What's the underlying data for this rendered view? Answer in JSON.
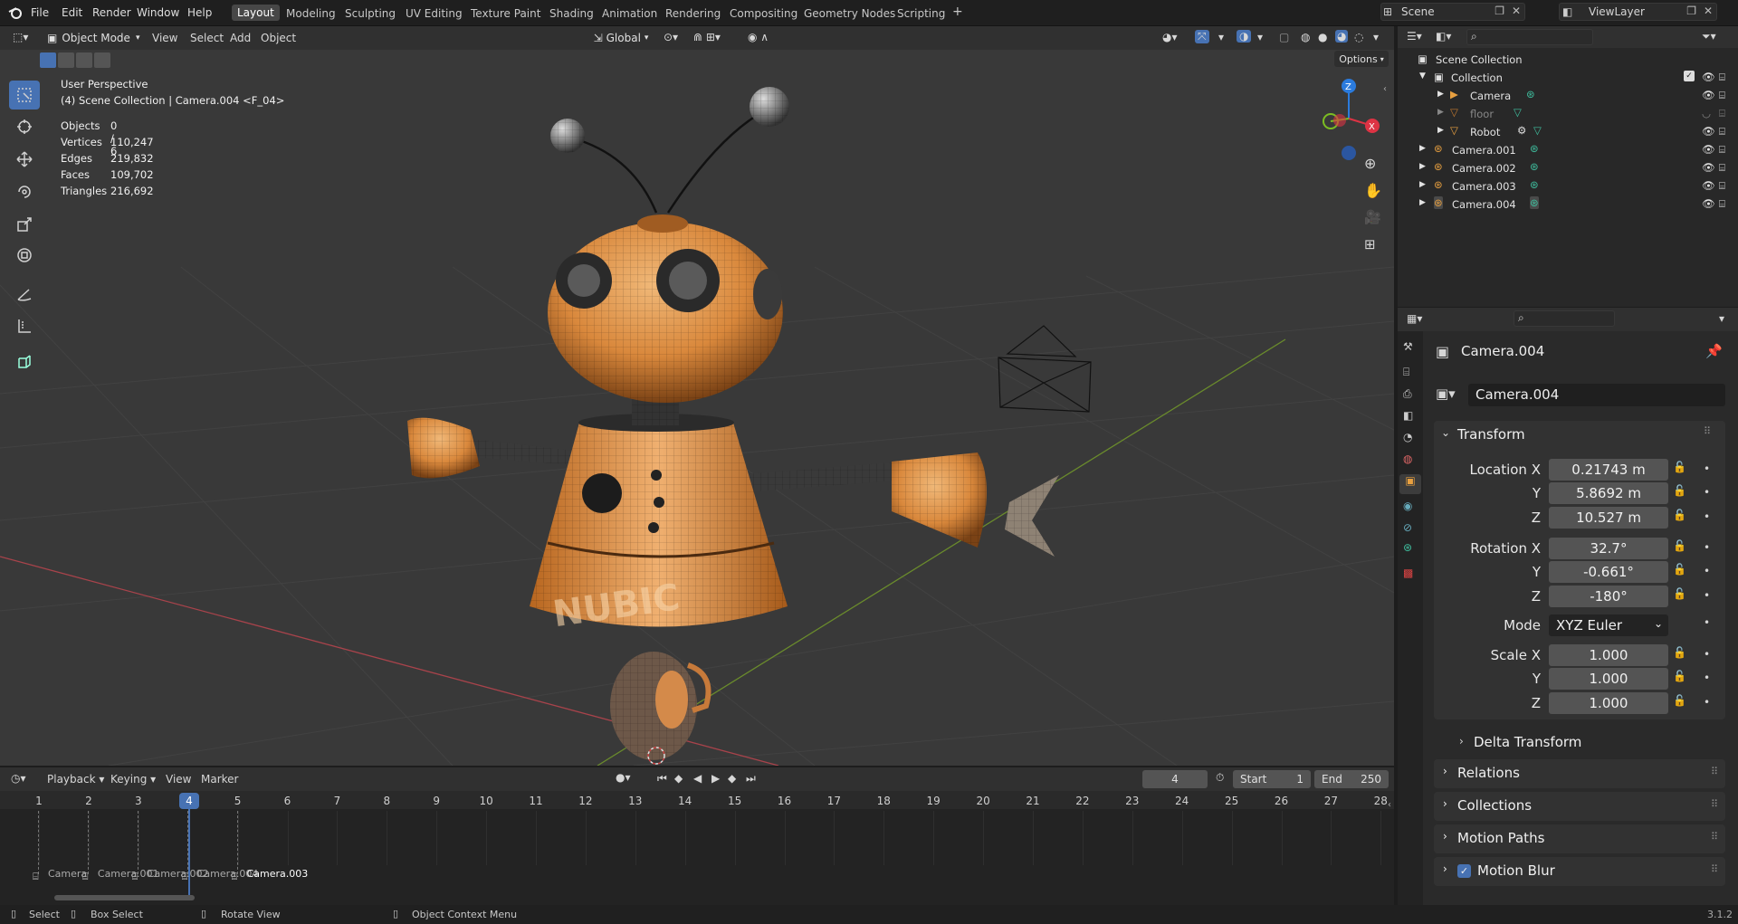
{
  "topbar": {
    "menus": [
      "File",
      "Edit",
      "Render",
      "Window",
      "Help"
    ],
    "workspaces": [
      "Layout",
      "Modeling",
      "Sculpting",
      "UV Editing",
      "Texture Paint",
      "Shading",
      "Animation",
      "Rendering",
      "Compositing",
      "Geometry Nodes",
      "Scripting"
    ],
    "active_workspace": "Layout",
    "add_tab": "+",
    "scene": "Scene",
    "view_layer": "ViewLayer"
  },
  "viewport": {
    "mode": "Object Mode",
    "menus": [
      "View",
      "Select",
      "Add",
      "Object"
    ],
    "orientation": "Global",
    "options": "Options",
    "perspective": "User Perspective",
    "collection_info": "(4) Scene Collection | Camera.004 <F_04>",
    "stats": [
      {
        "label": "Objects",
        "value": "0 / 6"
      },
      {
        "label": "Vertices",
        "value": "110,247"
      },
      {
        "label": "Edges",
        "value": "219,832"
      },
      {
        "label": "Faces",
        "value": "109,702"
      },
      {
        "label": "Triangles",
        "value": "216,692"
      }
    ],
    "gizmo": {
      "z": "Z",
      "y": "Y",
      "x": "X"
    },
    "model_text": "NUBIC"
  },
  "outliner": {
    "root": "Scene Collection",
    "items": [
      {
        "name": "Collection",
        "indent": 0
      },
      {
        "name": "Camera",
        "indent": 1
      },
      {
        "name": "floor",
        "indent": 1
      },
      {
        "name": "Robot",
        "indent": 1
      },
      {
        "name": "Camera.001",
        "indent": 0
      },
      {
        "name": "Camera.002",
        "indent": 0
      },
      {
        "name": "Camera.003",
        "indent": 0
      },
      {
        "name": "Camera.004",
        "indent": 0
      }
    ]
  },
  "properties": {
    "object_title": "Camera.004",
    "object_name": "Camera.004",
    "transform_label": "Transform",
    "location": {
      "label_x": "Location X",
      "label_y": "Y",
      "label_z": "Z",
      "x": "0.21743 m",
      "y": "5.8692 m",
      "z": "10.527 m"
    },
    "rotation": {
      "label_x": "Rotation X",
      "label_y": "Y",
      "label_z": "Z",
      "x": "32.7°",
      "y": "-0.661°",
      "z": "-180°"
    },
    "mode_label": "Mode",
    "mode_value": "XYZ Euler",
    "scale": {
      "label_x": "Scale X",
      "label_y": "Y",
      "label_z": "Z",
      "x": "1.000",
      "y": "1.000",
      "z": "1.000"
    },
    "delta": "Delta Transform",
    "sections": [
      "Relations",
      "Collections",
      "Motion Paths",
      "Motion Blur"
    ]
  },
  "timeline": {
    "menus": [
      "Playback",
      "Keying",
      "View",
      "Marker"
    ],
    "current_frame": "4",
    "start_label": "Start",
    "start": "1",
    "end_label": "End",
    "end": "250",
    "frames": [
      "1",
      "2",
      "3",
      "4",
      "5",
      "6",
      "7",
      "8",
      "9",
      "10",
      "11",
      "12",
      "13",
      "14",
      "15",
      "16",
      "17",
      "18",
      "19",
      "20",
      "21",
      "22",
      "23",
      "24",
      "25",
      "26",
      "27",
      "28"
    ],
    "markers": [
      "Camera",
      "Camera.001",
      "Camera.002",
      "Camera.004",
      "Camera.003"
    ]
  },
  "statusbar": {
    "select": "Select",
    "box_select": "Box Select",
    "rotate": "Rotate View",
    "context": "Object Context Menu",
    "version": "3.1.2"
  },
  "colors": {
    "accent": "#4772b3",
    "object": "#e87d0d",
    "camera_green": "#3fbf9f"
  }
}
